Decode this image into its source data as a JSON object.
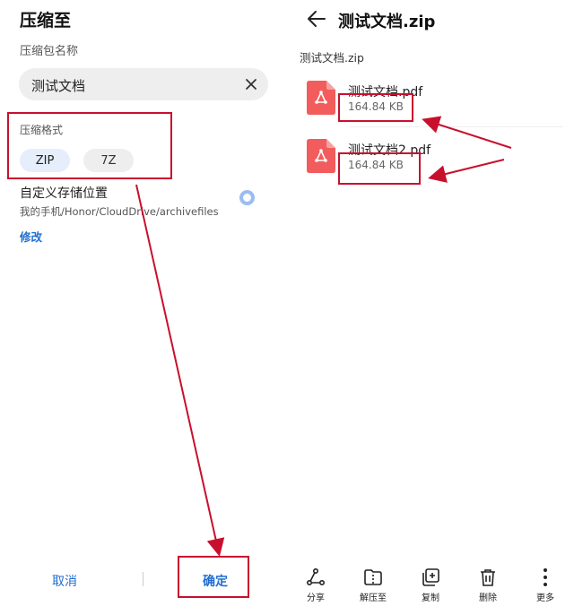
{
  "compress_dialog": {
    "title": "压缩至",
    "package_name_label": "压缩包名称",
    "package_name_value": "测试文档",
    "format_label": "压缩格式",
    "formats": [
      {
        "label": "ZIP",
        "selected": true
      },
      {
        "label": "7Z",
        "selected": false
      }
    ],
    "custom_location_title": "自定义存储位置",
    "custom_location_path": "我的手机/Honor/CloudDrive/archivefiles",
    "edit_label": "修改",
    "cancel_label": "取消",
    "confirm_label": "确定"
  },
  "archive_view": {
    "title": "测试文档.zip",
    "breadcrumb": "测试文档.zip",
    "files": [
      {
        "name": "测试文档.pdf",
        "size": "164.84 KB"
      },
      {
        "name": "测试文档2.pdf",
        "size": "164.84 KB"
      }
    ],
    "bottom_bar": [
      {
        "label": "分享",
        "icon": "share-icon"
      },
      {
        "label": "解压至",
        "icon": "extract-icon"
      },
      {
        "label": "复制",
        "icon": "copy-icon"
      },
      {
        "label": "删除",
        "icon": "delete-icon"
      },
      {
        "label": "更多",
        "icon": "more-icon"
      }
    ]
  },
  "colors": {
    "accent": "#1f6dd1",
    "annotation": "#c8102e",
    "pdf_icon": "#f25c5c",
    "chip_selected": "#e6eefb",
    "input_bg": "#eeeeee"
  }
}
